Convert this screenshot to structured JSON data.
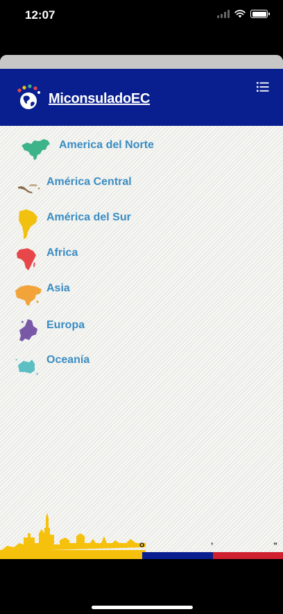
{
  "status_bar": {
    "time": "12:07"
  },
  "header": {
    "title": "MiconsuladoEC"
  },
  "continents": [
    {
      "label": "America del Norte",
      "icon": "north-america-map-icon",
      "color": "#3db38a"
    },
    {
      "label": "América Central",
      "icon": "central-america-map-icon",
      "color": "#8a6a4a"
    },
    {
      "label": "América del Sur",
      "icon": "south-america-map-icon",
      "color": "#f2c10f"
    },
    {
      "label": "Africa",
      "icon": "africa-map-icon",
      "color": "#e8474a"
    },
    {
      "label": "Asia",
      "icon": "asia-map-icon",
      "color": "#f2a43a"
    },
    {
      "label": "Europa",
      "icon": "europe-map-icon",
      "color": "#7a58a8"
    },
    {
      "label": "Oceanía",
      "icon": "oceania-map-icon",
      "color": "#5bbfc4"
    }
  ],
  "footer": {
    "marks": [
      "o",
      "’",
      "”"
    ],
    "flag_colors": [
      "#f5c10c",
      "#0a1f8f",
      "#d01f2f"
    ]
  }
}
